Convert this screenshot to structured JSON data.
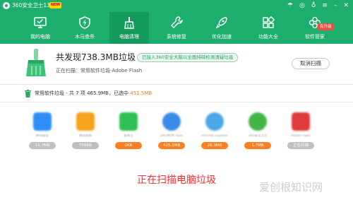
{
  "titlebar": {
    "title": "360安全卫士13",
    "badge": "NEW"
  },
  "nav": {
    "items": [
      {
        "label": "我的电脑",
        "icon": "monitor-icon"
      },
      {
        "label": "木马查杀",
        "icon": "shield-bolt-icon"
      },
      {
        "label": "电脑清理",
        "icon": "broom-icon"
      },
      {
        "label": "系统修复",
        "icon": "wrench-icon"
      },
      {
        "label": "优化加速",
        "icon": "rocket-icon"
      },
      {
        "label": "功能大全",
        "icon": "grid-icon"
      },
      {
        "label": "软件管家",
        "icon": "flower-icon",
        "badge": "有升级"
      }
    ],
    "active_index": 2
  },
  "scan": {
    "title": "共发现738.3MB垃圾",
    "tip": "已接入360安全大脑以全面排除检测清疑垃圾",
    "current": "正在扫描：常用软件垃圾-Adobe Flash",
    "cancel_label": "取消扫描"
  },
  "category": {
    "summary": "常用软件垃圾 - 共 7 项 465.9MB，已选中",
    "selected_size": "451.5MB"
  },
  "apps": [
    {
      "name": "腾讯会议",
      "size": "13.7MB",
      "selected": false,
      "color": "#2e8ff5"
    },
    {
      "name": "腾讯视频",
      "size": "708KB",
      "selected": false,
      "color": "#f7a21b"
    },
    {
      "name": "爱奇艺",
      "size": "0KB",
      "selected": true,
      "color": "#2fbf54"
    },
    {
      "name": "DAEMON Tools",
      "size": "425.3MB",
      "selected": true,
      "color": "#3a8be8"
    },
    {
      "name": "Internet Explorer",
      "size": "26.3MB",
      "selected": true,
      "color": "#4aa8e8"
    },
    {
      "name": "360安全卫士",
      "size": "1.7MB",
      "selected": true,
      "color": "#42b548"
    },
    {
      "name": "Adobe Flash",
      "size": "正在扫描",
      "selected": false,
      "color": "#e03a3a"
    }
  ],
  "caption": "正在扫描电脑垃圾",
  "watermark": "爱创根知识网",
  "colors": {
    "brand_green": "#1dae6e",
    "active_tab": "#159a5d",
    "orange": "#ff7e1f",
    "caption_red": "#ff2d2d"
  }
}
